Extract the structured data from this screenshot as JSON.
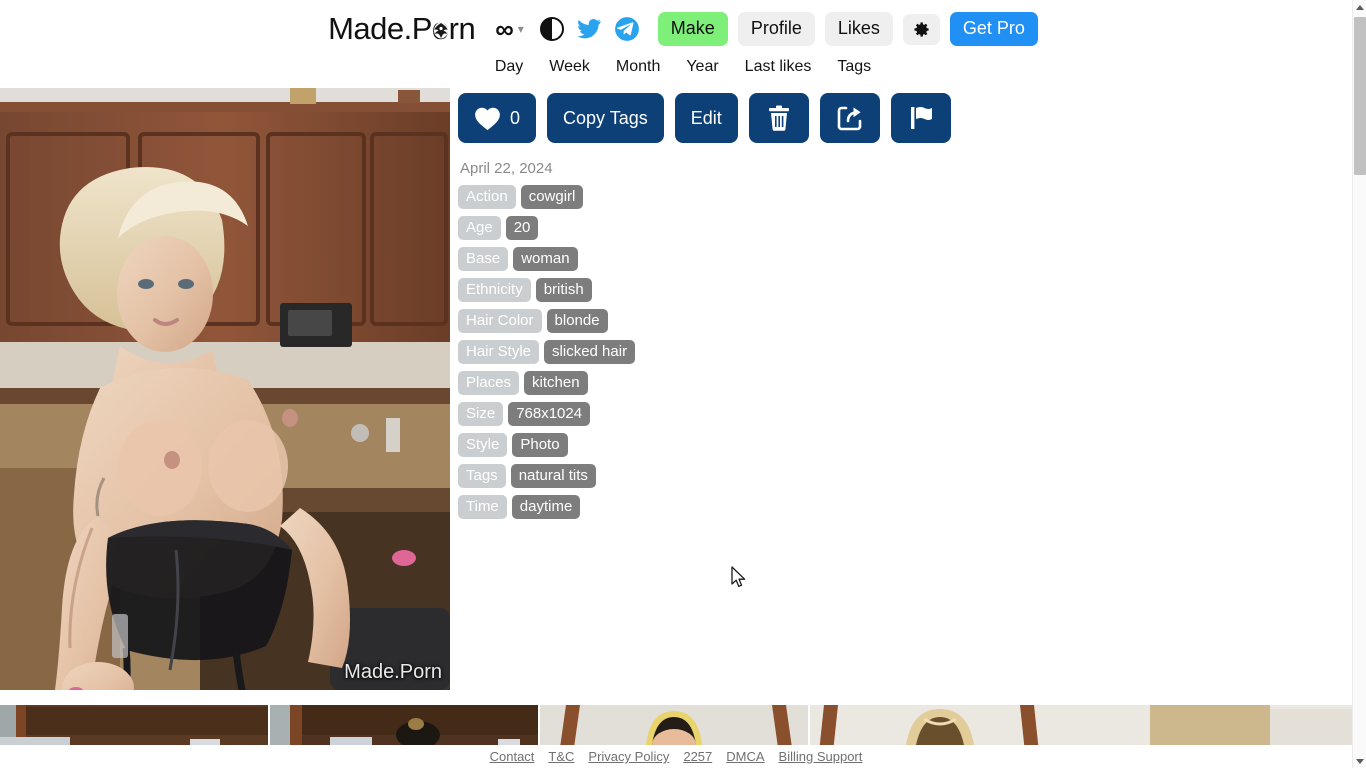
{
  "header": {
    "logo_text": "Made.Porn",
    "logo_emblem_icon": "eagle-emblem-icon",
    "model_selector": {
      "symbol": "∞",
      "chevron": "▾"
    },
    "theme_toggle_icon": "contrast-circle-icon",
    "twitter_icon": "twitter-bird-icon",
    "telegram_icon": "telegram-plane-icon",
    "buttons": {
      "make": "Make",
      "profile": "Profile",
      "likes": "Likes",
      "settings_icon": "gear-icon",
      "get_pro": "Get Pro"
    },
    "colors": {
      "make_bg": "#7ef07a",
      "plain_bg": "#efefef",
      "pro_bg": "#2090f5",
      "action_bg": "#0d4077"
    }
  },
  "subnav": {
    "items": [
      {
        "label": "Day"
      },
      {
        "label": "Week"
      },
      {
        "label": "Month"
      },
      {
        "label": "Year"
      },
      {
        "label": "Last likes"
      },
      {
        "label": "Tags"
      }
    ]
  },
  "photo": {
    "watermark": "Made.Porn",
    "alt": "generated photo of blonde woman in kitchen"
  },
  "actions": {
    "like_icon": "heart-icon",
    "like_count": "0",
    "copy_tags": "Copy Tags",
    "edit": "Edit",
    "delete_icon": "trash-icon",
    "share_icon": "share-box-arrow-icon",
    "report_icon": "flag-icon"
  },
  "details": {
    "date": "April 22, 2024",
    "attributes": [
      {
        "key": "Action",
        "value": "cowgirl"
      },
      {
        "key": "Age",
        "value": "20"
      },
      {
        "key": "Base",
        "value": "woman"
      },
      {
        "key": "Ethnicity",
        "value": "british"
      },
      {
        "key": "Hair Color",
        "value": "blonde"
      },
      {
        "key": "Hair Style",
        "value": "slicked hair"
      },
      {
        "key": "Places",
        "value": "kitchen"
      },
      {
        "key": "Size",
        "value": "768x1024"
      },
      {
        "key": "Style",
        "value": "Photo"
      },
      {
        "key": "Tags",
        "value": "natural tits"
      },
      {
        "key": "Time",
        "value": "daytime"
      }
    ]
  },
  "thumbnails": [
    {
      "id": "thumb-1"
    },
    {
      "id": "thumb-2"
    },
    {
      "id": "thumb-3"
    },
    {
      "id": "thumb-4"
    }
  ],
  "footer": {
    "links": [
      {
        "label": "Contact"
      },
      {
        "label": "T&C"
      },
      {
        "label": "Privacy Policy"
      },
      {
        "label": "2257"
      },
      {
        "label": "DMCA"
      },
      {
        "label": "Billing Support"
      }
    ]
  }
}
